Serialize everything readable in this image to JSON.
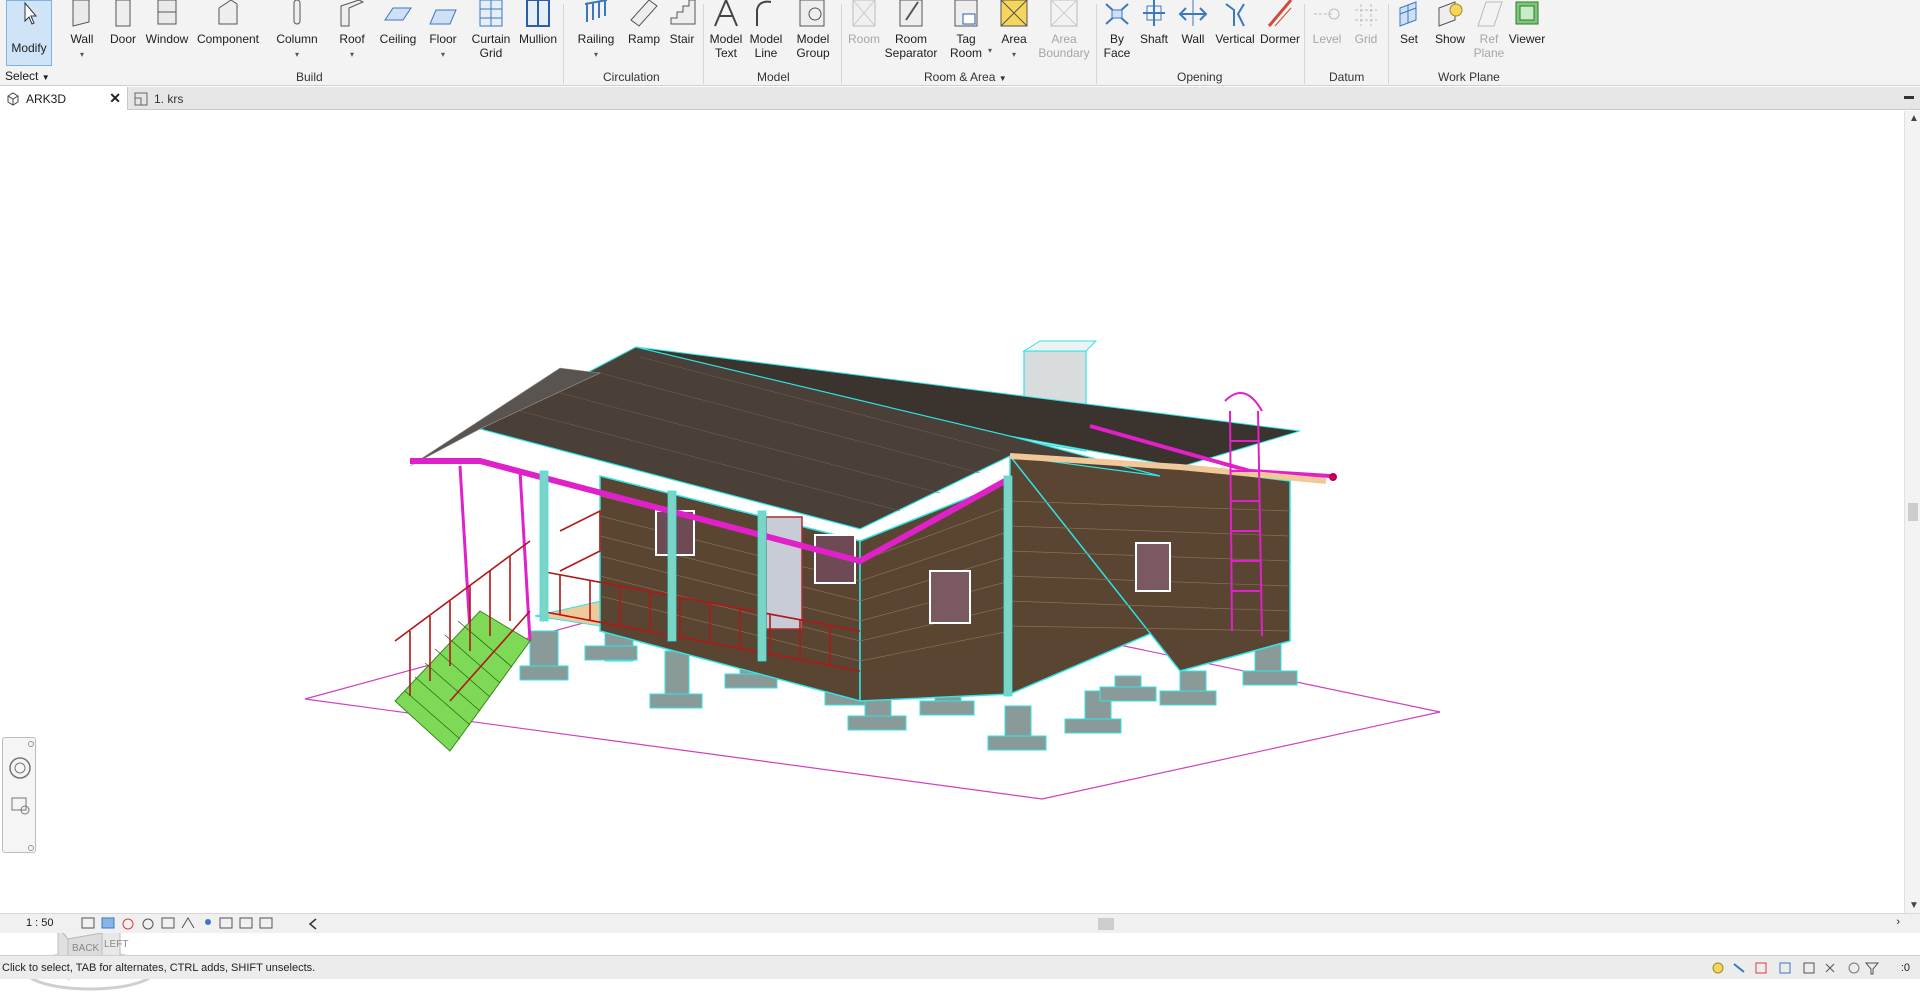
{
  "ribbon": {
    "modify": "Modify",
    "select_label": "Select",
    "build": {
      "panel": "Build",
      "wall": "Wall",
      "door": "Door",
      "window": "Window",
      "component": "Component",
      "column": "Column",
      "roof": "Roof",
      "ceiling": "Ceiling",
      "floor": "Floor",
      "curtain_1": "Curtain",
      "curtain_2": "Grid",
      "mullion": "Mullion"
    },
    "circulation": {
      "panel": "Circulation",
      "railing": "Railing",
      "ramp": "Ramp",
      "stair": "Stair"
    },
    "model": {
      "panel": "Model",
      "text_1": "Model",
      "text_2": "Text",
      "line_1": "Model",
      "line_2": "Line",
      "group_1": "Model",
      "group_2": "Group"
    },
    "room_area": {
      "panel": "Room & Area",
      "room": "Room",
      "sep_1": "Room",
      "sep_2": "Separator",
      "tag_1": "Tag",
      "tag_2": "Room",
      "area": "Area",
      "boundary_1": "Area",
      "boundary_2": "Boundary"
    },
    "opening": {
      "panel": "Opening",
      "byface_1": "By",
      "byface_2": "Face",
      "shaft": "Shaft",
      "wall": "Wall",
      "vertical": "Vertical",
      "dormer": "Dormer"
    },
    "datum": {
      "panel": "Datum",
      "level": "Level",
      "grid": "Grid"
    },
    "workplane": {
      "panel": "Work Plane",
      "set": "Set",
      "show": "Show",
      "ref_1": "Ref",
      "ref_2": "Plane",
      "viewer": "Viewer"
    }
  },
  "tabs": [
    {
      "label": "ARK3D"
    },
    {
      "label": "1. krs"
    }
  ],
  "viewcube": {
    "back": "BACK",
    "left": "LEFT"
  },
  "viewbar": {
    "scale": "1 : 50"
  },
  "status": {
    "text": "Click to select, TAB for alternates, CTRL adds, SHIFT unselects.",
    "selection_count": ":0"
  },
  "colors": {
    "accent": "#cfe4f7",
    "roof": "#4a4038",
    "wall": "#5a4532",
    "highlight_cyan": "#2ee6e6",
    "magenta": "#e020c8",
    "railing_red": "#b01818",
    "stair_green": "#7ed957",
    "trim": "#f0c89a"
  }
}
